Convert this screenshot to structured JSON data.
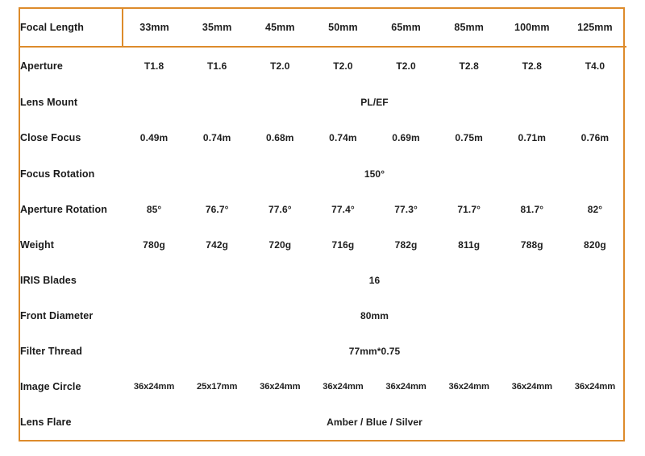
{
  "theme": {
    "accent": "#DD8B2B",
    "text": "#1a1a1a",
    "background": "#ffffff"
  },
  "table": {
    "label_header": "Focal Length",
    "columns": [
      "33mm",
      "35mm",
      "45mm",
      "50mm",
      "65mm",
      "85mm",
      "100mm",
      "125mm"
    ],
    "rows": [
      {
        "label": "Aperture",
        "span": false,
        "values": [
          "T1.8",
          "T1.6",
          "T2.0",
          "T2.0",
          "T2.0",
          "T2.8",
          "T2.8",
          "T4.0"
        ]
      },
      {
        "label": "Lens Mount",
        "span": true,
        "value": "PL/EF"
      },
      {
        "label": "Close Focus",
        "span": false,
        "values": [
          "0.49m",
          "0.74m",
          "0.68m",
          "0.74m",
          "0.69m",
          "0.75m",
          "0.71m",
          "0.76m"
        ]
      },
      {
        "label": "Focus Rotation",
        "span": true,
        "value": "150°"
      },
      {
        "label": "Aperture Rotation",
        "span": false,
        "values": [
          "85°",
          "76.7°",
          "77.6°",
          "77.4°",
          "77.3°",
          "71.7°",
          "81.7°",
          "82°"
        ]
      },
      {
        "label": "Weight",
        "span": false,
        "values": [
          "780g",
          "742g",
          "720g",
          "716g",
          "782g",
          "811g",
          "788g",
          "820g"
        ]
      },
      {
        "label": "IRIS Blades",
        "span": true,
        "value": "16"
      },
      {
        "label": "Front Diameter",
        "span": true,
        "value": "80mm"
      },
      {
        "label": "Filter Thread",
        "span": true,
        "value": "77mm*0.75"
      },
      {
        "label": "Image Circle",
        "span": false,
        "compact": true,
        "values": [
          "36x24mm",
          "25x17mm",
          "36x24mm",
          "36x24mm",
          "36x24mm",
          "36x24mm",
          "36x24mm",
          "36x24mm"
        ]
      },
      {
        "label": "Lens Flare",
        "span": true,
        "value": "Amber / Blue / Silver"
      }
    ]
  }
}
